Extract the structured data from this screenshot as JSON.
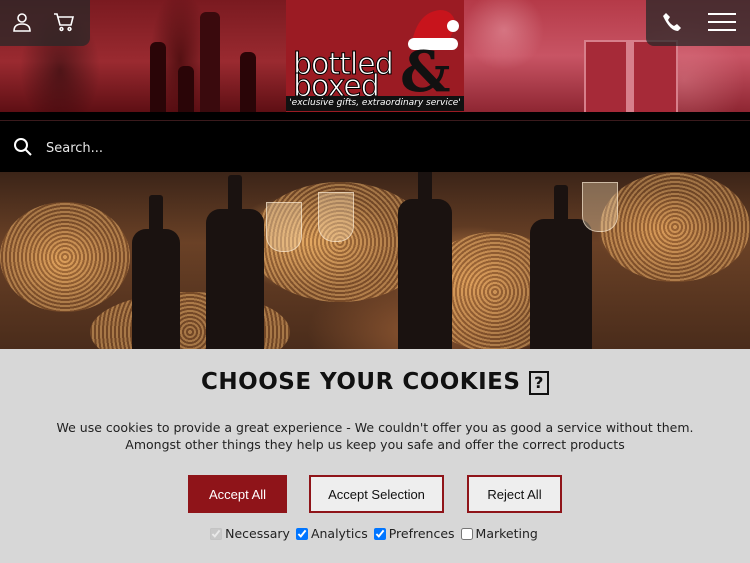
{
  "header": {
    "logo": {
      "line1": "bottled",
      "line2": "boxed",
      "amp": "&",
      "tagline": "'exclusive gifts, extraordinary service'"
    },
    "icons": {
      "account": "user-icon",
      "cart": "cart-icon",
      "phone": "phone-icon",
      "menu": "hamburger-menu-icon"
    }
  },
  "search": {
    "placeholder": "Search..."
  },
  "cookies": {
    "title": "CHOOSE YOUR COOKIES",
    "title_glyph": "?",
    "description": "We use cookies to provide a great experience - We couldn't offer you as good a service without them. Amongst other things they help us keep you safe and offer the correct products",
    "buttons": {
      "accept_all": "Accept All",
      "accept_selection": "Accept Selection",
      "reject_all": "Reject All"
    },
    "options": [
      {
        "label": "Necessary",
        "checked": true,
        "disabled": true
      },
      {
        "label": "Analytics",
        "checked": true,
        "disabled": false
      },
      {
        "label": "Prefrences",
        "checked": true,
        "disabled": false
      },
      {
        "label": "Marketing",
        "checked": false,
        "disabled": false
      }
    ]
  },
  "colors": {
    "brand": "#8f1419",
    "panel": "#d7d7d7",
    "search_bar": "#000000"
  }
}
